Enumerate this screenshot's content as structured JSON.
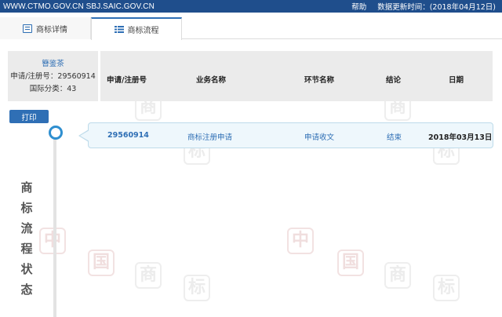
{
  "topbar": {
    "domains": "WWW.CTMO.GOV.CN SBJ.SAIC.GOV.CN",
    "help": "帮助",
    "updated": "数据更新时间：(2018年04月12日)"
  },
  "tabs": [
    {
      "label": "商标详情",
      "icon": "document-icon"
    },
    {
      "label": "商标流程",
      "icon": "list-icon"
    }
  ],
  "trademark": {
    "name": "簪鉴茶",
    "reg_no": "申请/注册号：29560914",
    "class": "国际分类：43"
  },
  "table": {
    "headers": [
      "申请/注册号",
      "业务名称",
      "环节名称",
      "结论",
      "日期"
    ],
    "rows": [
      {
        "reg_no": "29560914",
        "business": "商标注册申请",
        "step": "申请收文",
        "result": "结束",
        "date": "2018年03月13日"
      }
    ]
  },
  "print_label": "打印",
  "side_title": [
    "商",
    "标",
    "流",
    "程",
    "状",
    "态"
  ],
  "watermark": {
    "chars": [
      "中",
      "国",
      "商",
      "标"
    ],
    "colors": {
      "red": "#f0dede",
      "gray": "#ececec"
    }
  },
  "colors": {
    "primary": "#2f6fb5",
    "topbar": "#1f4e8c",
    "timeline_node": "#2f8fd0"
  }
}
